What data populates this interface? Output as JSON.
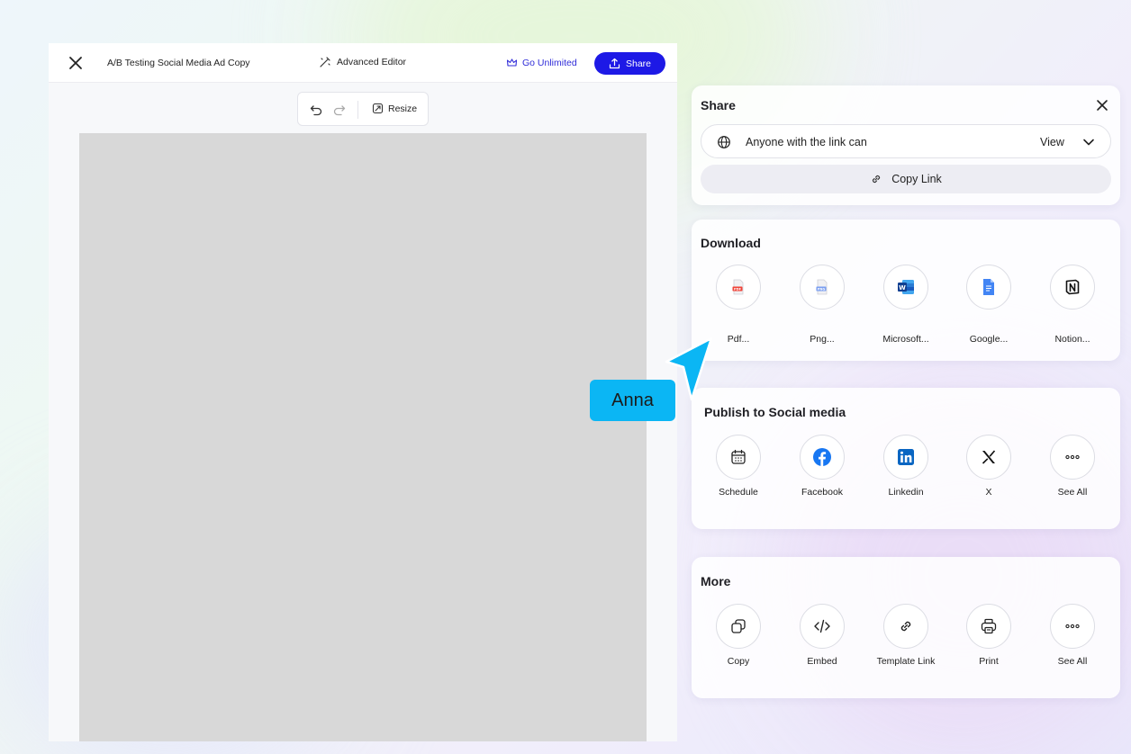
{
  "editor": {
    "doc_title": "A/B Testing Social Media Ad Copy",
    "advanced_editor": "Advanced Editor",
    "go_unlimited": "Go Unlimited",
    "share": "Share",
    "resize": "Resize"
  },
  "share_panel": {
    "title": "Share",
    "permission_text": "Anyone with the link can",
    "permission_value": "View",
    "copy_link": "Copy Link"
  },
  "download_panel": {
    "title": "Download",
    "items": [
      {
        "label": "Pdf...",
        "icon": "pdf-icon"
      },
      {
        "label": "Png...",
        "icon": "png-icon"
      },
      {
        "label": "Microsoft...",
        "icon": "microsoft-word-icon"
      },
      {
        "label": "Google...",
        "icon": "google-docs-icon"
      },
      {
        "label": "Notion...",
        "icon": "notion-icon"
      }
    ]
  },
  "social_panel": {
    "title": "Publish to Social media",
    "items": [
      {
        "label": "Schedule",
        "icon": "calendar-icon"
      },
      {
        "label": "Facebook",
        "icon": "facebook-icon"
      },
      {
        "label": "Linkedin",
        "icon": "linkedin-icon"
      },
      {
        "label": "X",
        "icon": "x-icon"
      },
      {
        "label": "See All",
        "icon": "more-icon"
      }
    ]
  },
  "more_panel": {
    "title": "More",
    "items": [
      {
        "label": "Copy",
        "icon": "copy-icon"
      },
      {
        "label": "Embed",
        "icon": "embed-icon"
      },
      {
        "label": "Template Link",
        "icon": "link-icon"
      },
      {
        "label": "Print",
        "icon": "print-icon"
      },
      {
        "label": "See All",
        "icon": "more-icon"
      }
    ]
  },
  "cursor": {
    "user_name": "Anna"
  },
  "colors": {
    "primary": "#1d19e6",
    "cursor": "#0bb6f4",
    "canvas": "#d8d8d8"
  }
}
